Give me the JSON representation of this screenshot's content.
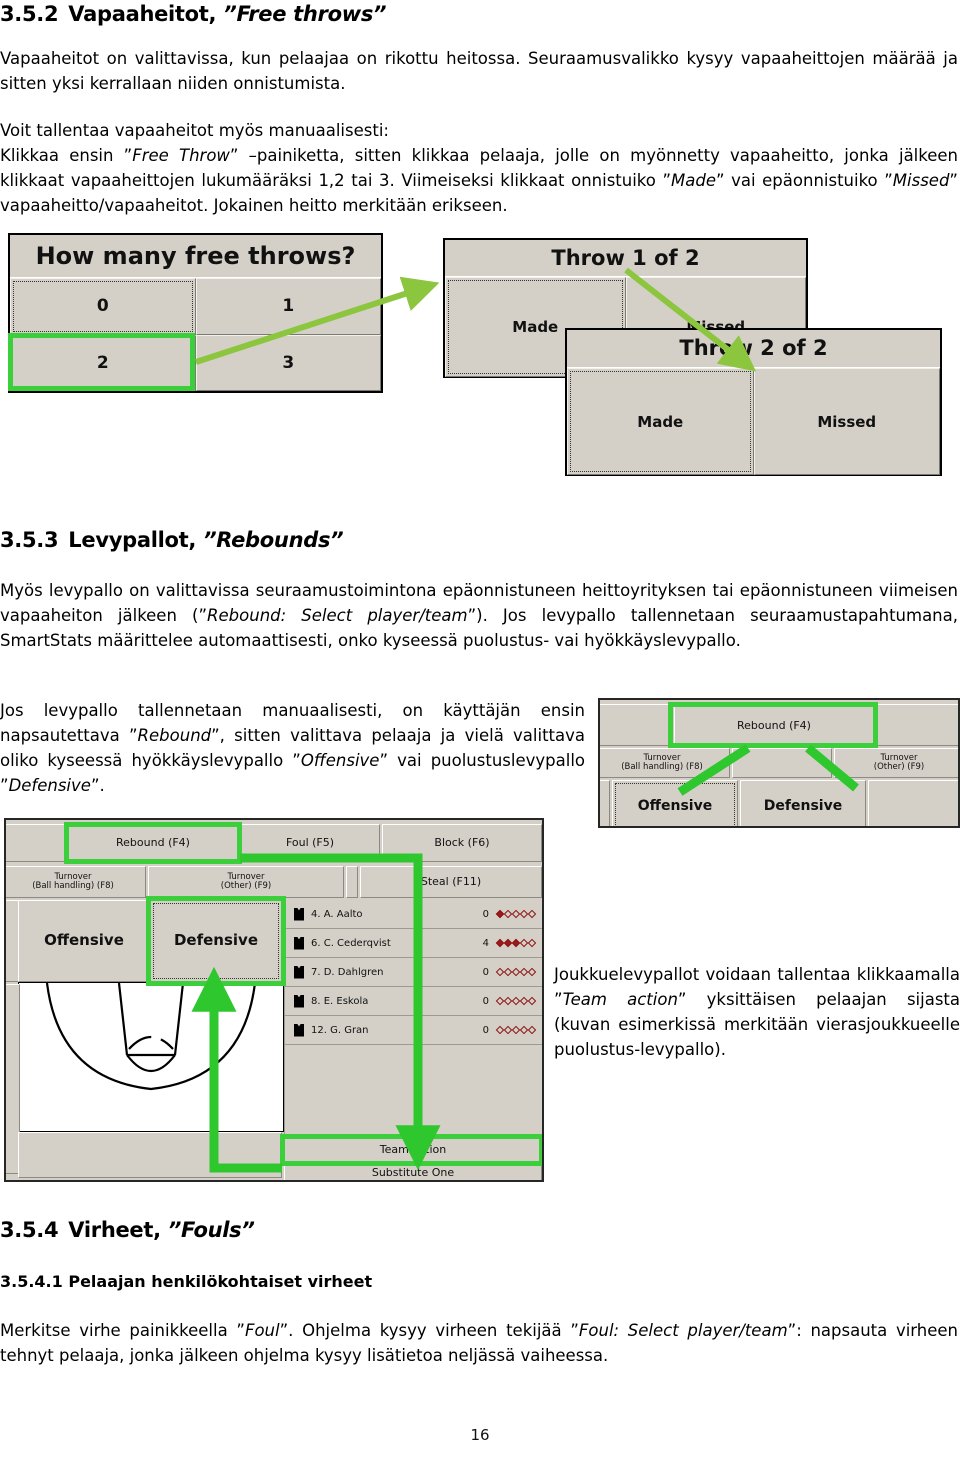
{
  "document": {
    "page_number": "16",
    "sections": [
      {
        "number": "3.5.2",
        "title_plain": "Vapaaheitot, ",
        "title_quoted_italic": "”Free throws”"
      }
    ]
  },
  "s352": {
    "heading_num": "3.5.2",
    "heading_text": "Vapaaheitot, ",
    "heading_em": "”Free throws”",
    "p1": "Vapaaheitot on valittavissa, kun pelaajaa on rikottu heitossa. Seuraamusvalikko kysyy vapaaheittojen määrää ja sitten yksi kerrallaan niiden onnistumista.",
    "p2_line1": "Voit tallentaa vapaaheitot myös manuaalisesti:",
    "p2_a": "Klikkaa ensin ”",
    "p2_em1": "Free Throw",
    "p2_b": "” –painiketta, sitten klikkaa pelaaja, jolle on myönnetty vapaaheitto, jonka jälkeen klikkaat vapaaheittojen lukumääräksi 1,2 tai 3. Viimeiseksi klikkaat onnistuiko ”",
    "p2_em2": "Made",
    "p2_c": "” vai epäonnistuiko ”",
    "p2_em3": "Missed",
    "p2_d": "” vapaaheitto/vapaaheitot. Jokainen heitto merkitään erikseen."
  },
  "fig_freethrows": {
    "dialog_howmany": {
      "title": "How many free throws?",
      "buttons": [
        "0",
        "1",
        "2",
        "3"
      ],
      "focused_button": "0",
      "highlighted_button": "2"
    },
    "dialog_throw1": {
      "title": "Throw 1 of 2",
      "buttons": [
        "Made",
        "Missed"
      ],
      "focused_button": "Made"
    },
    "dialog_throw2": {
      "title": "Throw 2 of 2",
      "buttons": [
        "Made",
        "Missed"
      ],
      "focused_button": "Made"
    },
    "annotation_color": "#8cc63f",
    "highlight_color": "#3bcf3b"
  },
  "s353": {
    "heading_num": "3.5.3",
    "heading_text": "Levypallot, ",
    "heading_em": "”Rebounds”",
    "p1_a": "Myös levypallo on valittavissa seuraamustoimintona epäonnistuneen heittoyrityksen tai epäonnistuneen viimeisen vapaaheiton jälkeen (”",
    "p1_em1": "Rebound: Select player/team",
    "p1_b": "”). Jos levypallo tallennetaan seuraamustapahtumana, SmartStats määrittelee automaattisesti, onko kyseessä puolustus- vai hyökkäyslevypallo.",
    "p2_a": "Jos levypallo tallennetaan manuaalisesti, on käyttäjän ensin napsautettava ”",
    "p2_em1": "Rebound",
    "p2_b": "”, sitten valittava pelaaja ja vielä valittava oliko kyseessä hyökkäyslevypallo ”",
    "p2_em2": "Offensive",
    "p2_c": "” vai puolustuslevypallo ”",
    "p2_em3": "Defensive",
    "p2_d": "”.",
    "p3_a": "Joukkuelevypallot voidaan tallentaa klikkaamalla ”",
    "p3_em1": "Team action",
    "p3_b": "” yksittäisen pelaajan sijasta (kuvan esimerkissä merkitään vierasjoukkueelle puolustus-levypallo)."
  },
  "fig_rebound_small": {
    "buttons": {
      "rebound": "Rebound (F4)",
      "turnover_ball": "Turnover\n(Ball handling) (F8)",
      "turnover_ball_l1": "Turnover",
      "turnover_ball_l2": "(Ball handling) (F8)",
      "turnover_other_l1": "Turnover",
      "turnover_other_l2": "(Other) (F9)",
      "offensive": "Offensive",
      "defensive": "Defensive"
    },
    "highlighted": "Rebound (F4)",
    "focused": "Offensive"
  },
  "fig_rebound_large": {
    "buttons": {
      "rebound": "Rebound (F4)",
      "foul": "Foul (F5)",
      "block": "Block (F6)",
      "turnover_ball_l1": "Turnover",
      "turnover_ball_l2": "(Ball handling) (F8)",
      "turnover_other_l1": "Turnover",
      "turnover_other_l2": "(Other) (F9)",
      "steal": "Steal (F11)",
      "offensive": "Offensive",
      "defensive": "Defensive",
      "team_action": "Team action",
      "substitute_one": "Substitute One"
    },
    "highlighted": [
      "Rebound (F4)",
      "Defensive",
      "Team action"
    ],
    "players": [
      {
        "name": "4. A. Aalto",
        "value": "0",
        "fouls": 1
      },
      {
        "name": "6. C. Cederqvist",
        "value": "4",
        "fouls": 3
      },
      {
        "name": "7. D. Dahlgren",
        "value": "0",
        "fouls": 0
      },
      {
        "name": "8. E. Eskola",
        "value": "0",
        "fouls": 0
      },
      {
        "name": "12. G. Gran",
        "value": "0",
        "fouls": 0
      }
    ],
    "foul_dots_per_row": 5
  },
  "s354": {
    "heading_num": "3.5.4",
    "heading_text": "Virheet, ",
    "heading_em": "”Fouls”",
    "sub_heading": "3.5.4.1 Pelaajan henkilökohtaiset virheet",
    "p1_a": "Merkitse virhe painikkeella ”",
    "p1_em1": "Foul",
    "p1_b": "”. Ohjelma kysyy virheen tekijää ”",
    "p1_em2": "Foul: Select player/team",
    "p1_c": "”: napsauta virheen tehnyt pelaaja, jonka jälkeen ohjelma kysyy lisätietoa neljässä vaiheessa."
  },
  "colors": {
    "ui_gray": "#d4d0c8",
    "highlight_green": "#3bcf3b",
    "arrow_green": "#8cc63f",
    "foul_dot_red": "#9e1b1b"
  }
}
